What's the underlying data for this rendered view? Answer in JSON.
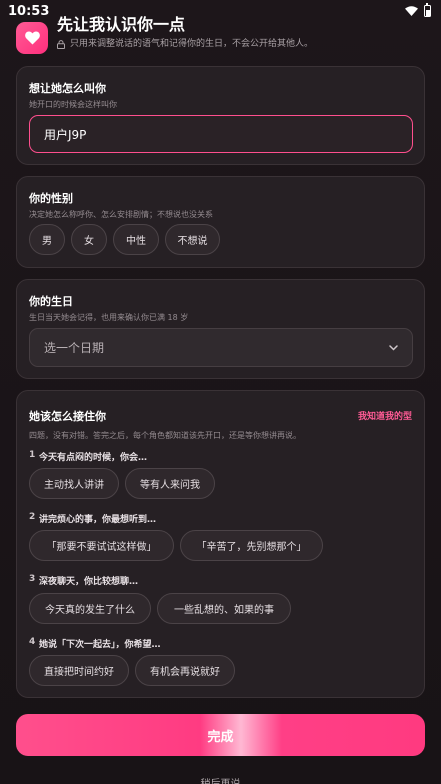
{
  "status_bar": {
    "time": "10:53"
  },
  "header": {
    "title": "先让我认识你一点",
    "privacy_note": "只用来调整说话的语气和记得你的生日，不会公开给其他人。"
  },
  "name_card": {
    "title": "想让她怎么叫你",
    "subtitle": "她开口的时候会这样叫你",
    "input_value": "用户J9P"
  },
  "gender_card": {
    "title": "你的性别",
    "subtitle": "决定她怎么称呼你、怎么安排剧情；不想说也没关系",
    "options": [
      "男",
      "女",
      "中性",
      "不想说"
    ]
  },
  "birthday_card": {
    "title": "你的生日",
    "subtitle": "生日当天她会记得，也用来确认你已满 18 岁",
    "placeholder": "选一个日期"
  },
  "quiz_card": {
    "title": "她该怎么接住你",
    "link": "我知道我的型",
    "intro": "四题，没有对错。答完之后，每个角色都知道该先开口，还是等你想讲再说。",
    "questions": [
      {
        "num": "1",
        "text": "今天有点闷的时候，你会…",
        "options": [
          "主动找人讲讲",
          "等有人来问我"
        ]
      },
      {
        "num": "2",
        "text": "讲完烦心的事，你最想听到…",
        "options": [
          "「那要不要试试这样做」",
          "「辛苦了，先别想那个」"
        ]
      },
      {
        "num": "3",
        "text": "深夜聊天，你比较想聊…",
        "options": [
          "今天真的发生了什么",
          "一些乱想的、如果的事"
        ]
      },
      {
        "num": "4",
        "text": "她说「下次一起去」，你希望…",
        "options": [
          "直接把时间约好",
          "有机会再说就好"
        ]
      }
    ]
  },
  "footer": {
    "done_label": "完成",
    "later_label": "稍后再说"
  },
  "colors": {
    "accent": "#ff4f8e",
    "background": "#1a1418",
    "card": "#262024"
  }
}
